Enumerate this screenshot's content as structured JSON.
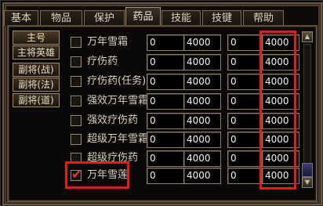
{
  "tabs": [
    {
      "label": "基本"
    },
    {
      "label": "物品"
    },
    {
      "label": "保护"
    },
    {
      "label": "药品"
    },
    {
      "label": "技能"
    },
    {
      "label": "技键"
    },
    {
      "label": "帮助"
    }
  ],
  "active_tab": "药品",
  "roles": [
    {
      "label": "主号"
    },
    {
      "label": "主将英雄"
    },
    {
      "label": "副将(战)"
    },
    {
      "label": "副将(法)"
    },
    {
      "label": "副将(道)"
    }
  ],
  "items": [
    {
      "name": "万年雪霜",
      "checked": false,
      "f1": "0",
      "f2": "4000",
      "f3": "0",
      "f4": "4000"
    },
    {
      "name": "疗伤药",
      "checked": false,
      "f1": "0",
      "f2": "4000",
      "f3": "0",
      "f4": "4000"
    },
    {
      "name": "疗伤药(任务)",
      "checked": false,
      "f1": "0",
      "f2": "4000",
      "f3": "0",
      "f4": "4000"
    },
    {
      "name": "强效万年雪霜",
      "checked": false,
      "f1": "0",
      "f2": "4000",
      "f3": "0",
      "f4": "4000"
    },
    {
      "name": "强效疗伤药",
      "checked": false,
      "f1": "0",
      "f2": "4000",
      "f3": "0",
      "f4": "4000"
    },
    {
      "name": "超级万年雪霜",
      "checked": false,
      "f1": "0",
      "f2": "4000",
      "f3": "0",
      "f4": "4000"
    },
    {
      "name": "超级疗伤药",
      "checked": false,
      "f1": "0",
      "f2": "4000",
      "f3": "0",
      "f4": "4000"
    },
    {
      "name": "万年雪莲",
      "checked": true,
      "f1": "0",
      "f2": "4000",
      "f3": "0",
      "f4": "4000"
    }
  ],
  "icons": {
    "check": "✔",
    "scroll_up": "▲",
    "scroll_down": "▼"
  },
  "colors": {
    "highlight": "#e01e1e",
    "check": "#e33434"
  }
}
